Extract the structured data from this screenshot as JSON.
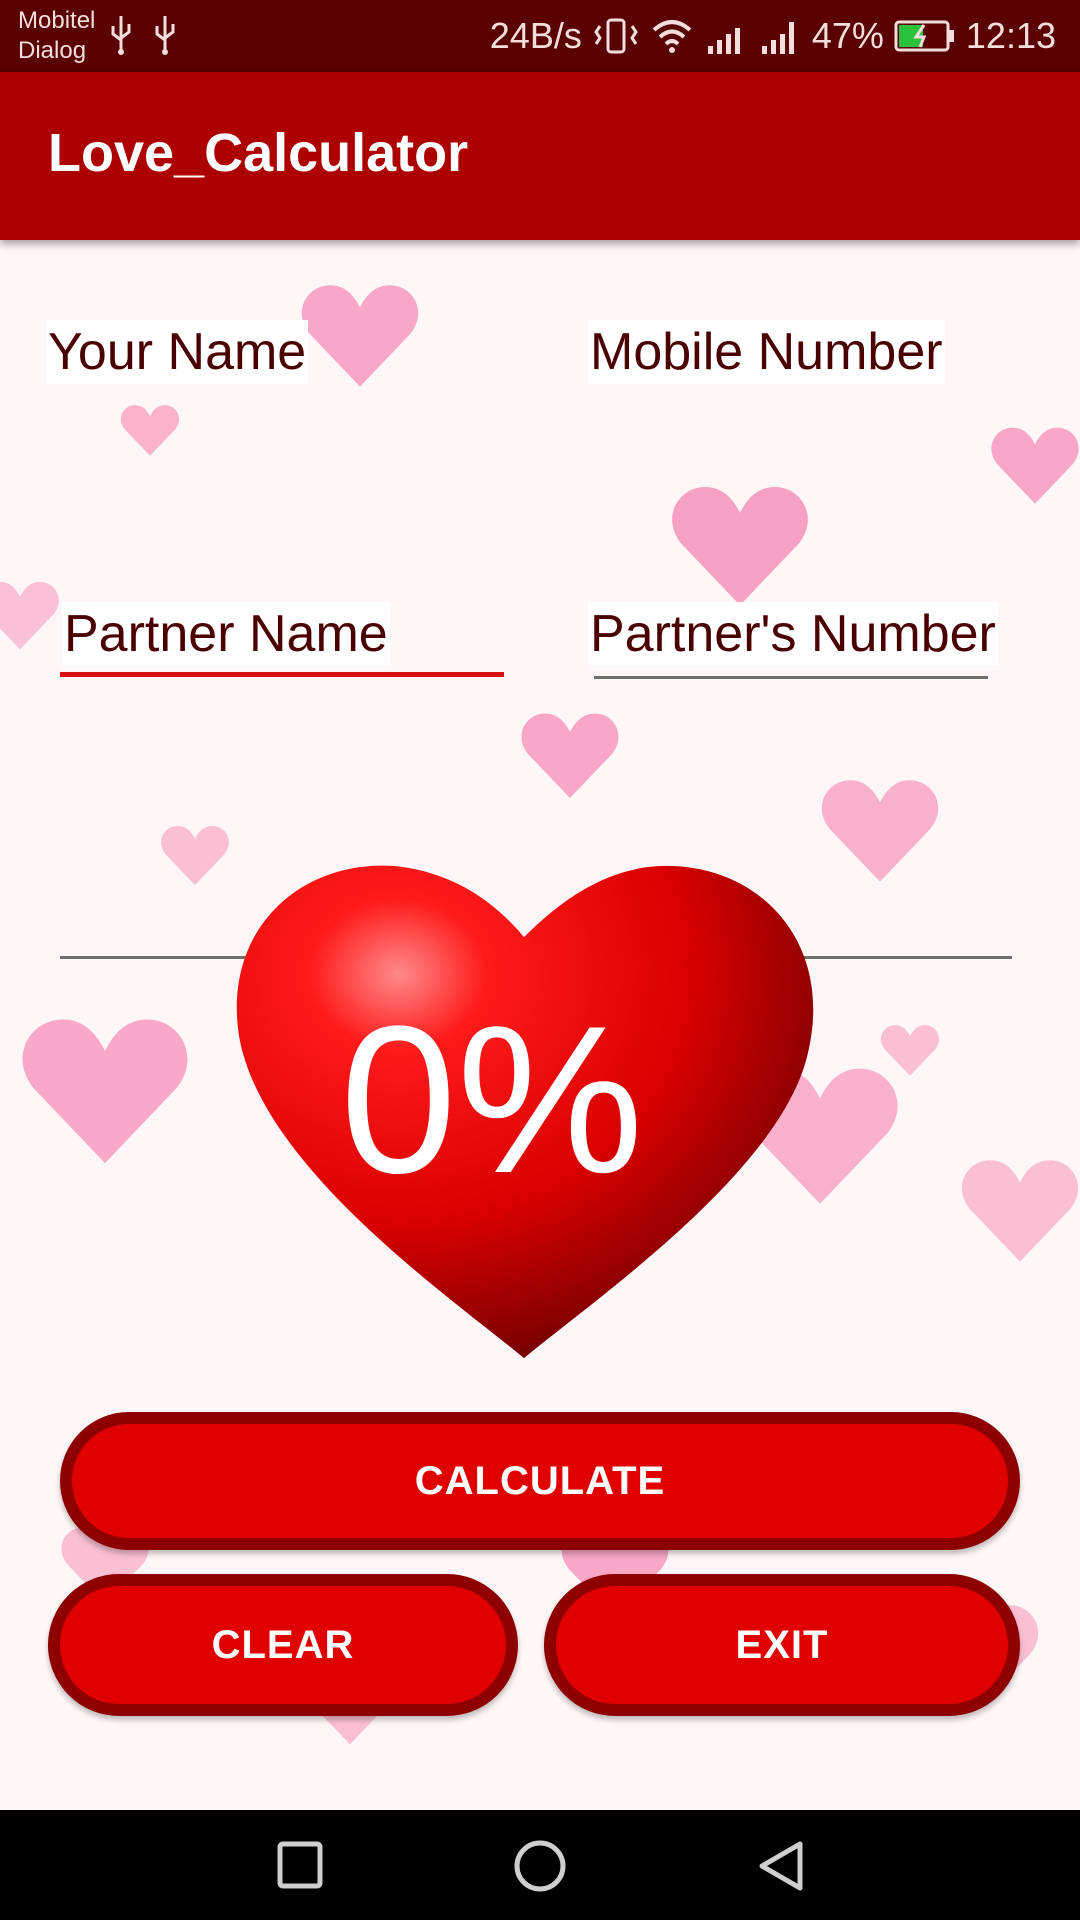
{
  "status_bar": {
    "carrier_1": "Mobitel",
    "carrier_2": "Dialog",
    "speed": "24B/s",
    "battery": "47%",
    "time": "12:13"
  },
  "app_bar": {
    "title": "Love_Calculator"
  },
  "form": {
    "your_name_label": "Your Name",
    "mobile_number_label": "Mobile Number",
    "partner_name_label": "Partner Name",
    "partners_number_label": "Partner's Number",
    "your_name_value": "",
    "mobile_number_value": "",
    "partner_name_value": "",
    "partners_number_value": ""
  },
  "result": {
    "percent": "0%"
  },
  "buttons": {
    "calculate": "CALCULATE",
    "clear": "CLEAR",
    "exit": "EXIT"
  },
  "colors": {
    "status_bar": "#5a0000",
    "app_bar": "#ad0000",
    "button_fill": "#e00000",
    "button_border": "#8e0000",
    "accent_underline": "#d81010"
  },
  "icons": [
    "usb-icon",
    "vibrate-icon",
    "wifi-icon",
    "signal-icon",
    "battery-icon",
    "recent-apps-icon",
    "home-icon",
    "back-icon",
    "heart-icon"
  ]
}
